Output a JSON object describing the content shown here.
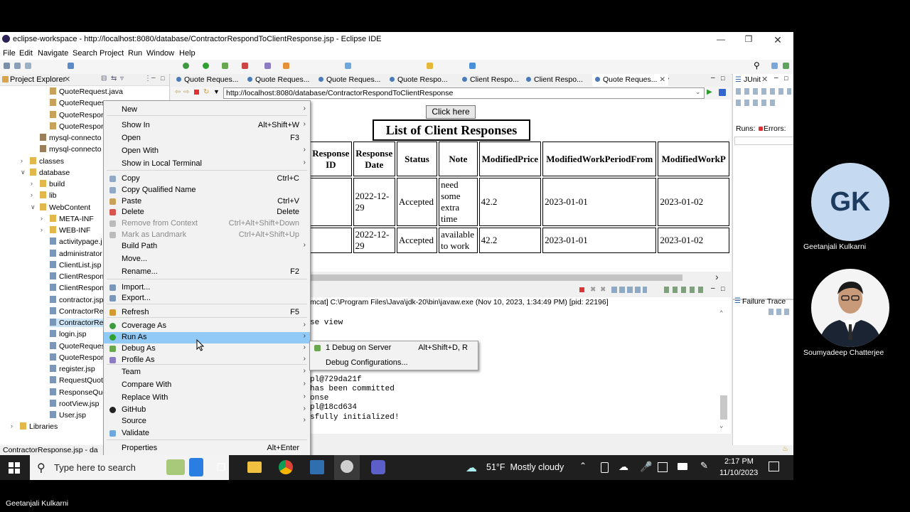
{
  "window": {
    "title": "eclipse-workspace - http://localhost:8080/database/ContractorRespondToClientResponse.jsp - Eclipse IDE"
  },
  "menubar": [
    "File",
    "Edit",
    "Navigate",
    "Search",
    "Project",
    "Run",
    "Window",
    "Help"
  ],
  "project_explorer": {
    "title": "Project Explorer",
    "items": [
      {
        "label": "QuoteRequest.java",
        "indent": 84,
        "kind": "java"
      },
      {
        "label": "QuoteReques",
        "indent": 84,
        "kind": "java"
      },
      {
        "label": "QuoteRespor",
        "indent": 84,
        "kind": "java"
      },
      {
        "label": "QuoteRespor",
        "indent": 84,
        "kind": "java"
      },
      {
        "label": "mysql-connecto",
        "indent": 70,
        "kind": "jar"
      },
      {
        "label": "mysql-connecto",
        "indent": 70,
        "kind": "jar"
      },
      {
        "label": "classes",
        "indent": 56,
        "kind": "folder"
      },
      {
        "label": "database",
        "indent": 56,
        "kind": "folder"
      },
      {
        "label": "build",
        "indent": 70,
        "kind": "folder"
      },
      {
        "label": "lib",
        "indent": 70,
        "kind": "folder"
      },
      {
        "label": "WebContent",
        "indent": 70,
        "kind": "folder"
      },
      {
        "label": "META-INF",
        "indent": 84,
        "kind": "folder"
      },
      {
        "label": "WEB-INF",
        "indent": 84,
        "kind": "folder"
      },
      {
        "label": "activitypage.j",
        "indent": 84,
        "kind": "jsp"
      },
      {
        "label": "administrator",
        "indent": 84,
        "kind": "jsp"
      },
      {
        "label": "ClientList.jsp",
        "indent": 84,
        "kind": "jsp"
      },
      {
        "label": "ClientRespon",
        "indent": 84,
        "kind": "jsp"
      },
      {
        "label": "ClientRespon",
        "indent": 84,
        "kind": "jsp"
      },
      {
        "label": "contractor.jsp",
        "indent": 84,
        "kind": "jsp"
      },
      {
        "label": "ContractorRe",
        "indent": 84,
        "kind": "jsp"
      },
      {
        "label": "ContractorRe",
        "indent": 84,
        "kind": "jsp",
        "selected": true
      },
      {
        "label": "login.jsp",
        "indent": 84,
        "kind": "jsp"
      },
      {
        "label": "QuoteReques",
        "indent": 84,
        "kind": "jsp"
      },
      {
        "label": "QuoteRespor",
        "indent": 84,
        "kind": "jsp"
      },
      {
        "label": "register.jsp",
        "indent": 84,
        "kind": "jsp"
      },
      {
        "label": "RequestQuot",
        "indent": 84,
        "kind": "jsp"
      },
      {
        "label": "ResponseQuo",
        "indent": 84,
        "kind": "jsp"
      },
      {
        "label": "rootView.jsp",
        "indent": 84,
        "kind": "jsp"
      },
      {
        "label": "User.jsp",
        "indent": 84,
        "kind": "jsp"
      },
      {
        "label": "Libraries",
        "indent": 42,
        "kind": "folder"
      }
    ]
  },
  "editor_tabs": [
    "Quote Reques...",
    "Quote Reques...",
    "Quote Reques...",
    "Quote Respo...",
    "Client Respo...",
    "Client Respo...",
    "Quote Reques..."
  ],
  "browser": {
    "url": "http://localhost:8080/database/ContractorRespondToClientResponse",
    "click_button": "Click here",
    "list_title": "List of Client Responses",
    "columns": [
      "Response ID",
      "Response Date",
      "Status",
      "Note",
      "ModifiedPrice",
      "ModifiedWorkPeriodFrom",
      "ModifiedWorkP"
    ],
    "rows": [
      [
        "",
        "2022-12-29",
        "Accepted",
        "need some extra time",
        "42.2",
        "2023-01-01",
        "2023-01-02"
      ],
      [
        "",
        "2022-12-29",
        "Accepted",
        "available to work",
        "42.2",
        "2023-01-01",
        "2023-01-02"
      ]
    ]
  },
  "console": {
    "path": "mcat] C:\\Program Files\\Java\\jdk-20\\bin\\javaw.exe  (Nov 10, 2023, 1:34:49 PM) [pid: 22196]",
    "lines": [
      "se view",
      "pl@729da21f",
      "has been committed",
      "onse",
      "pl@18cd634",
      "sfully initialized!"
    ]
  },
  "junit": {
    "title": "JUnit",
    "runs_label": "Runs:",
    "errors_label": "Errors:",
    "failure_trace": "Failure Trace"
  },
  "status_bar": {
    "text": "ContractorResponse.jsp - da"
  },
  "context_menu": {
    "items": [
      {
        "label": "New",
        "submenu": true
      },
      {
        "sep": true
      },
      {
        "label": "Show In",
        "shortcut": "Alt+Shift+W",
        "submenu": true
      },
      {
        "label": "Open",
        "shortcut": "F3"
      },
      {
        "label": "Open With",
        "submenu": true
      },
      {
        "label": "Show in Local Terminal",
        "submenu": true
      },
      {
        "sep": true
      },
      {
        "label": "Copy",
        "shortcut": "Ctrl+C",
        "icon": "copy-icon"
      },
      {
        "label": "Copy Qualified Name",
        "icon": "copy-icon"
      },
      {
        "label": "Paste",
        "shortcut": "Ctrl+V",
        "icon": "paste-icon"
      },
      {
        "label": "Delete",
        "shortcut": "Delete",
        "icon": "delete-icon"
      },
      {
        "label": "Remove from Context",
        "shortcut": "Ctrl+Alt+Shift+Down",
        "disabled": true,
        "icon": "remove-icon"
      },
      {
        "label": "Mark as Landmark",
        "shortcut": "Ctrl+Alt+Shift+Up",
        "disabled": true,
        "icon": "landmark-icon"
      },
      {
        "label": "Build Path",
        "submenu": true
      },
      {
        "label": "Move..."
      },
      {
        "label": "Rename...",
        "shortcut": "F2"
      },
      {
        "sep": true
      },
      {
        "label": "Import...",
        "icon": "import-icon"
      },
      {
        "label": "Export...",
        "icon": "export-icon"
      },
      {
        "sep": true
      },
      {
        "label": "Refresh",
        "shortcut": "F5",
        "icon": "refresh-icon"
      },
      {
        "sep": true
      },
      {
        "label": "Coverage As",
        "submenu": true,
        "icon": "coverage-icon"
      },
      {
        "label": "Run As",
        "submenu": true,
        "highlighted": true,
        "icon": "run-icon"
      },
      {
        "label": "Debug As",
        "submenu": true,
        "icon": "debug-icon"
      },
      {
        "label": "Profile As",
        "submenu": true,
        "icon": "profile-icon"
      },
      {
        "sep": true
      },
      {
        "label": "Team",
        "submenu": true
      },
      {
        "label": "Compare With",
        "submenu": true
      },
      {
        "label": "Replace With",
        "submenu": true
      },
      {
        "label": "GitHub",
        "submenu": true,
        "icon": "github-icon"
      },
      {
        "label": "Source",
        "submenu": true
      },
      {
        "label": "Validate",
        "icon": "validate-icon"
      },
      {
        "sep": true
      },
      {
        "label": "Properties",
        "shortcut": "Alt+Enter"
      }
    ]
  },
  "run_as_submenu": [
    {
      "label": "1 Debug on Server",
      "shortcut": "Alt+Shift+D, R"
    },
    {
      "label": "Debug Configurations..."
    }
  ],
  "taskbar": {
    "search_placeholder": "Type here to search",
    "weather": "51°F  Mostly cloudy",
    "time": "2:17 PM",
    "date": "11/10/2023"
  },
  "participants": [
    {
      "name": "Geetanjali Kulkarni",
      "initials": "GK"
    },
    {
      "name": "Soumyadeep Chatterjee"
    }
  ],
  "self_view_name": "Geetanjali Kulkarni",
  "colors": {
    "accent": "#91c9f7",
    "avatar_bg": "#c5daf0",
    "avatar_text": "#1d3b5e"
  }
}
